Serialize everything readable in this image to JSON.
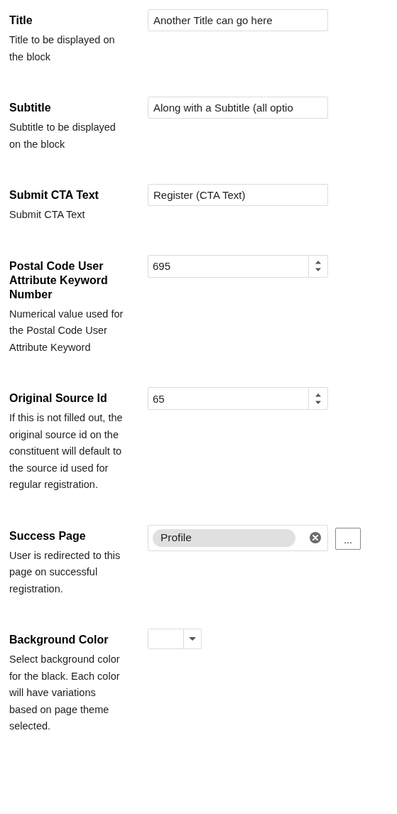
{
  "fields": [
    {
      "label": "Title",
      "description": "Title to be displayed on the block",
      "kind": "text",
      "value": "Another Title can go here"
    },
    {
      "label": "Subtitle",
      "description": "Subtitle to be displayed on the block",
      "kind": "text",
      "value": "Along with a Subtitle (all optio"
    },
    {
      "label": "Submit CTA Text",
      "description": "Submit CTA Text",
      "kind": "text",
      "value": "Register (CTA Text)"
    },
    {
      "label": "Postal Code User Attribute Keyword Number",
      "description": "Numerical value used for the Postal Code User Attribute Keyword",
      "kind": "number",
      "value": "695"
    },
    {
      "label": "Original Source Id",
      "description": "If this is not filled out, the original source id on the constituent will default to the source id used for regular registration.",
      "kind": "number",
      "value": "65"
    },
    {
      "label": "Success Page",
      "description": "User is redirected to this page on successful registration.",
      "kind": "picker",
      "value": "Profile",
      "button": "..."
    },
    {
      "label": "Background Color",
      "description": "Select background color for the black. Each color will have variations based on page theme selected.",
      "kind": "color",
      "color": "#ffffff"
    }
  ]
}
